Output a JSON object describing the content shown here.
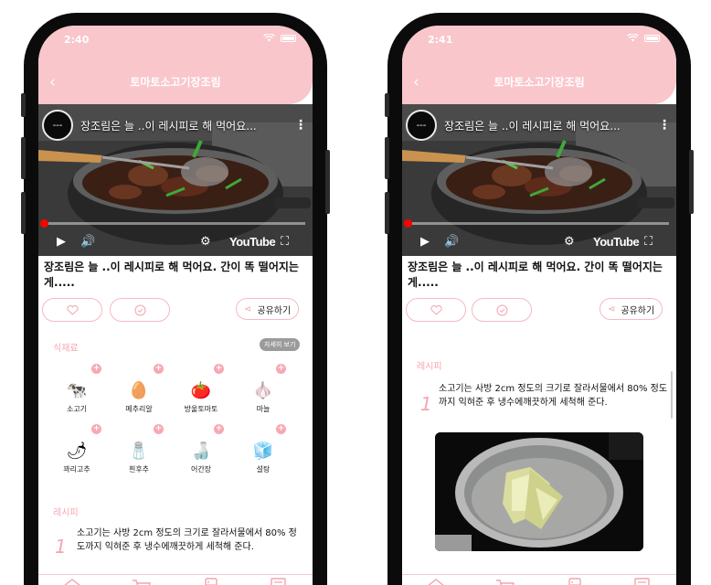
{
  "screens": [
    {
      "status_time": "2:40",
      "header_title": "토마토소고기장조림",
      "video": {
        "channel_avatar": "---",
        "title": "장조림은 늘 ..이 레시피로 해 먹어요...",
        "youtube_label": "YouTube",
        "progress": 0.01
      },
      "recipe_title": "장조림은 늘 ..이 레시피로 해 먹어요. 간이 똑 떨어지는게.....",
      "share_label": "공유하기",
      "ingredients_label": "식재료",
      "detail_label": "자세히 보기",
      "ingredients": [
        {
          "name": "소고기",
          "icon": "beef-icon",
          "glyph": "🐄"
        },
        {
          "name": "메추리알",
          "icon": "egg-icon",
          "glyph": "🥚"
        },
        {
          "name": "방울토마토",
          "icon": "tomato-icon",
          "glyph": "🍅"
        },
        {
          "name": "마늘",
          "icon": "garlic-icon",
          "glyph": "🧄"
        },
        {
          "name": "꽈리고추",
          "icon": "pepper-icon",
          "glyph": "🌶"
        },
        {
          "name": "흰후추",
          "icon": "pepper-grinder-icon",
          "glyph": "🧂"
        },
        {
          "name": "어간장",
          "icon": "soy-sauce-icon",
          "glyph": "🍶"
        },
        {
          "name": "설탕",
          "icon": "sugar-cube-icon",
          "glyph": "🧊"
        }
      ],
      "recipe_label": "레시피",
      "step": {
        "number": "1",
        "text": "소고기는 사방 2cm 정도의 크기로 잘라서물에서 80% 정도까지 익혀준 후 냉수에깨끗하게 세척해 준다."
      }
    },
    {
      "status_time": "2:41",
      "header_title": "토마토소고기장조림",
      "video": {
        "channel_avatar": "---",
        "title": "장조림은 늘 ..이 레시피로 해 먹어요...",
        "youtube_label": "YouTube",
        "progress": 0.01
      },
      "recipe_title": "장조림은 늘 ..이 레시피로 해 먹어요. 간이 똑 떨어지는게.....",
      "share_label": "공유하기",
      "recipe_label": "레시피",
      "step": {
        "number": "1",
        "text": "소고기는 사방 2cm 정도의 크기로 잘라서물에서 80% 정도까지 익혀준 후 냉수에깨끗하게 세척해 준다."
      }
    }
  ],
  "colors": {
    "accent": "#f9c6cc",
    "accent_dark": "#f5a6b0",
    "youtube_red": "#ff0000"
  },
  "bottom_tabs": [
    "home-icon",
    "cart-icon",
    "fridge-icon",
    "recipe-book-icon"
  ]
}
